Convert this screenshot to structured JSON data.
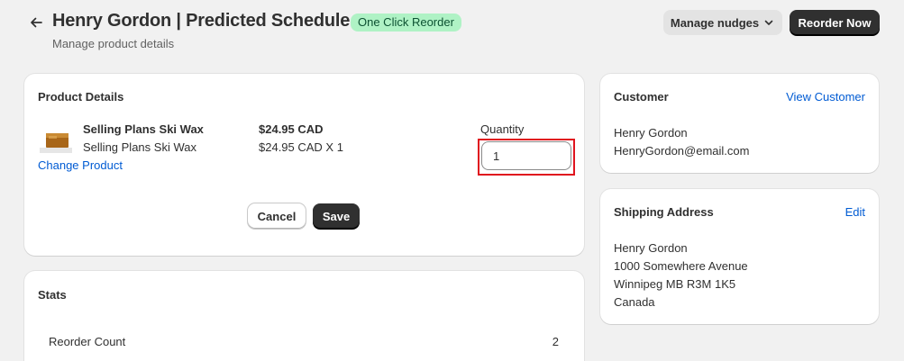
{
  "header": {
    "title": "Henry Gordon | Predicted Schedule",
    "badge": "One Click Reorder",
    "subtitle": "Manage product details",
    "nudges_label": "Manage nudges",
    "reorder_label": "Reorder Now"
  },
  "product_details": {
    "title": "Product Details",
    "product_name": "Selling Plans Ski Wax",
    "variant_name": "Selling Plans Ski Wax",
    "change_link": "Change Product",
    "price": "$24.95 CAD",
    "price_qty": "$24.95 CAD X 1",
    "quantity_label": "Quantity",
    "quantity_value": "1",
    "cancel_label": "Cancel",
    "save_label": "Save"
  },
  "stats": {
    "title": "Stats",
    "rows": [
      {
        "label": "Reorder Count",
        "value": "2"
      }
    ]
  },
  "customer": {
    "title": "Customer",
    "link": "View Customer",
    "name": "Henry Gordon",
    "email": "HenryGordon@email.com"
  },
  "shipping": {
    "title": "Shipping Address",
    "link": "Edit",
    "lines": [
      "Henry Gordon",
      "1000 Somewhere Avenue",
      "Winnipeg MB R3M 1K5",
      "Canada"
    ]
  },
  "colors": {
    "accent_link": "#005bd3",
    "badge_bg": "#aff2c5",
    "badge_text": "#0c5132",
    "primary_button": "#303030",
    "highlight": "#e0141e"
  },
  "icons": {
    "back": "arrow-left-icon",
    "nudges": "chevron-down-icon",
    "product": "product-thumbnail"
  }
}
